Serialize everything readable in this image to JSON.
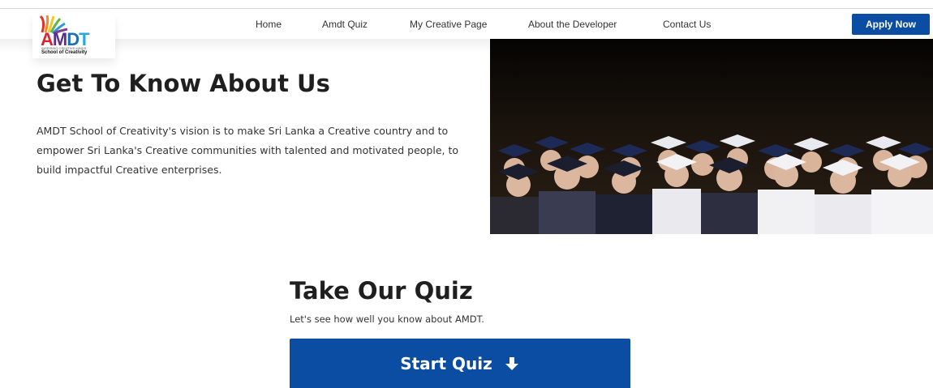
{
  "nav": {
    "logo": {
      "letters": [
        "A",
        "M",
        "D",
        "T"
      ],
      "tagline": "INSPIRING CREATIVE MINDS",
      "subtitle": "School of Creativity"
    },
    "links": [
      {
        "label": "Home"
      },
      {
        "label": "Amdt Quiz"
      },
      {
        "label": "My Creative Page"
      },
      {
        "label": "About the Developer"
      },
      {
        "label": "Contact Us"
      }
    ],
    "apply_label": "Apply Now"
  },
  "about": {
    "title": "Get To Know About Us",
    "paragraph": "AMDT School of Creativity's vision is to make Sri Lanka a Creative country and to empower Sri Lanka's Creative communities with talented and motivated people, to build impactful Creative enterprises.",
    "photo_icon": "graduation-photo"
  },
  "quiz": {
    "title": "Take Our Quiz",
    "subtitle": "Let's see how well you know about AMDT.",
    "button_label": "Start Quiz",
    "button_icon": "arrow-down-icon"
  },
  "colors": {
    "primary": "#0a4da2",
    "text_dark": "#1f1f1f",
    "logo_red": "#d7262f",
    "logo_purple": "#5a2f8c",
    "logo_blue": "#1d6fb8",
    "logo_cyan": "#2aa6de"
  }
}
